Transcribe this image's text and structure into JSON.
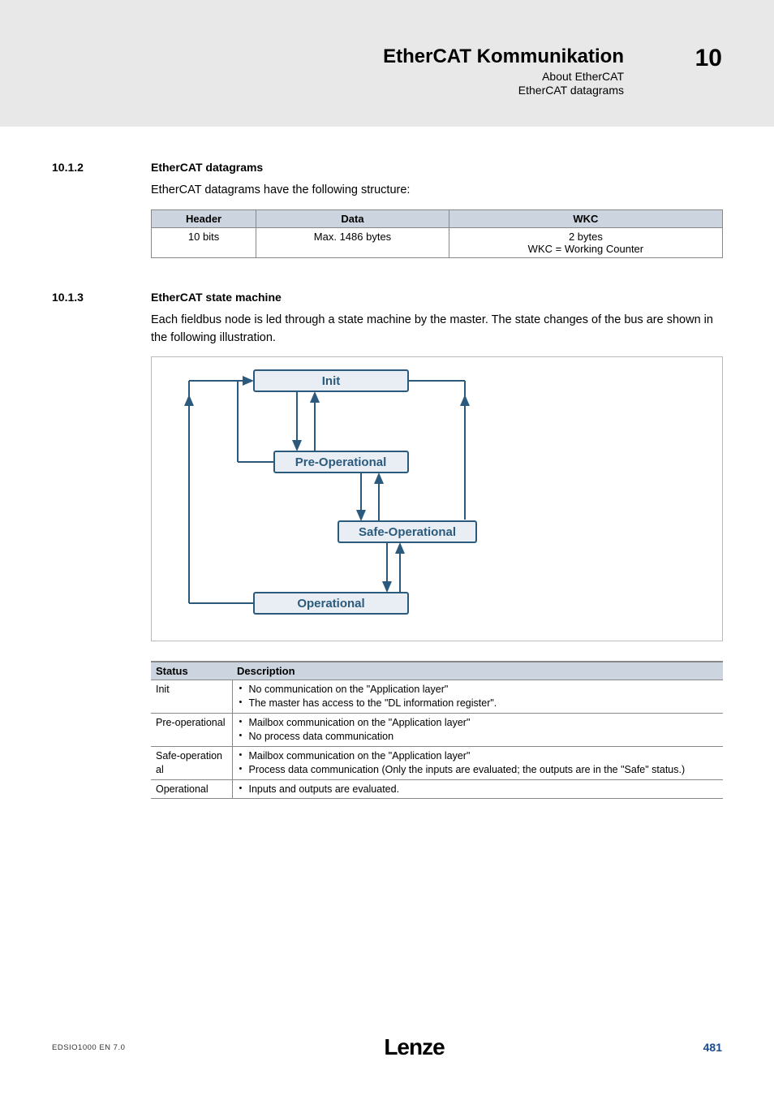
{
  "header": {
    "title": "EtherCAT Kommunikation",
    "subtitle": "About EtherCAT",
    "subsubtitle": "EtherCAT datagrams",
    "chapter_number": "10"
  },
  "section_10_1_2": {
    "number": "10.1.2",
    "title": "EtherCAT datagrams",
    "intro": "EtherCAT datagrams have the following structure:",
    "table": {
      "headers": [
        "Header",
        "Data",
        "WKC"
      ],
      "rows": [
        [
          "10 bits",
          "Max. 1486 bytes",
          "2 bytes\nWKC = Working Counter"
        ]
      ]
    }
  },
  "section_10_1_3": {
    "number": "10.1.3",
    "title": "EtherCAT state machine",
    "intro": "Each fieldbus node is led through a state machine by the master. The state changes of the bus are shown in the following illustration.",
    "diagram": {
      "states": [
        "Init",
        "Pre-Operational",
        "Safe-Operational",
        "Operational"
      ]
    },
    "status_table": {
      "columns": [
        "Status",
        "Description"
      ],
      "rows": [
        {
          "status": "Init",
          "items": [
            "No communication on the \"Application layer\"",
            "The master has access to the \"DL information register\"."
          ]
        },
        {
          "status": "Pre-operational",
          "items": [
            "Mailbox communication on the \"Application layer\"",
            "No process data communication"
          ]
        },
        {
          "status": "Safe-operational",
          "items": [
            "Mailbox communication on the \"Application layer\"",
            "Process data communication (Only the inputs are evaluated; the outputs are in the \"Safe\" status.)"
          ]
        },
        {
          "status": "Operational",
          "items": [
            "Inputs and outputs are evaluated."
          ]
        }
      ]
    }
  },
  "footer": {
    "doc_id": "EDSIO1000 EN 7.0",
    "logo": "Lenze",
    "page": "481"
  }
}
